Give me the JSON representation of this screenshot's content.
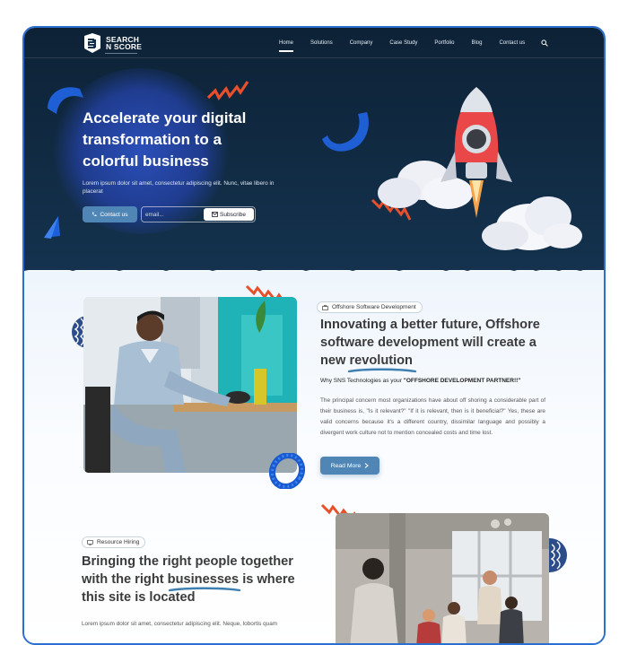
{
  "brand": {
    "line1": "SEARCH",
    "line2": "N SCORE"
  },
  "nav": {
    "items": [
      {
        "label": "Home",
        "active": true
      },
      {
        "label": "Solutions",
        "active": false
      },
      {
        "label": "Company",
        "active": false
      },
      {
        "label": "Case Study",
        "active": false
      },
      {
        "label": "Portfolio",
        "active": false
      },
      {
        "label": "Blog",
        "active": false
      },
      {
        "label": "Contact us",
        "active": false
      }
    ],
    "search_icon": "search-icon"
  },
  "hero": {
    "title": "Accelerate your digital transformation to a colorful business",
    "subtitle": "Lorem ipsum dolor sit amet, consectetur adipiscing elit. Nunc, vitae libero in placerat",
    "contact_label": "Contact us",
    "email_placeholder": "email...",
    "subscribe_label": "Subscribe"
  },
  "section1": {
    "badge": "Offshore Software Development",
    "heading_line1": "Innovating a better future, Offshore",
    "heading_line2": "software development will create a",
    "heading_prefix": "new ",
    "heading_highlight": "revolution",
    "why_prefix": "Why SNS Technologies as your ",
    "why_bold": "\"OFFSHORE DEVELOPMENT PARTNER!!\"",
    "paragraph": "The principal concern most organizations have about off shoring a considerable part of their business is, \"Is it relevant?\" \"If it is relevant, then is it beneficial?\" Yes, these are valid concerns because it's a different country, dissimilar language and possibly a divergent work culture not to mention concealed costs and time lost.",
    "read_more_label": "Read More"
  },
  "section2": {
    "badge": "Resource Hiring",
    "heading_line1": "Bringing the right people together",
    "heading_prefix": "with the right ",
    "heading_highlight": "businesses",
    "heading_suffix": " is where",
    "heading_line3": "this site is located",
    "paragraph": "Lorem ipsum dolor sit amet, consectetur adipiscing elit. Neque, lobortis quam"
  },
  "colors": {
    "hero_bg": "#11304a",
    "accent_blue": "#4f86b6",
    "zigzag": "#e5502e",
    "underline": "#3d7fb0"
  }
}
